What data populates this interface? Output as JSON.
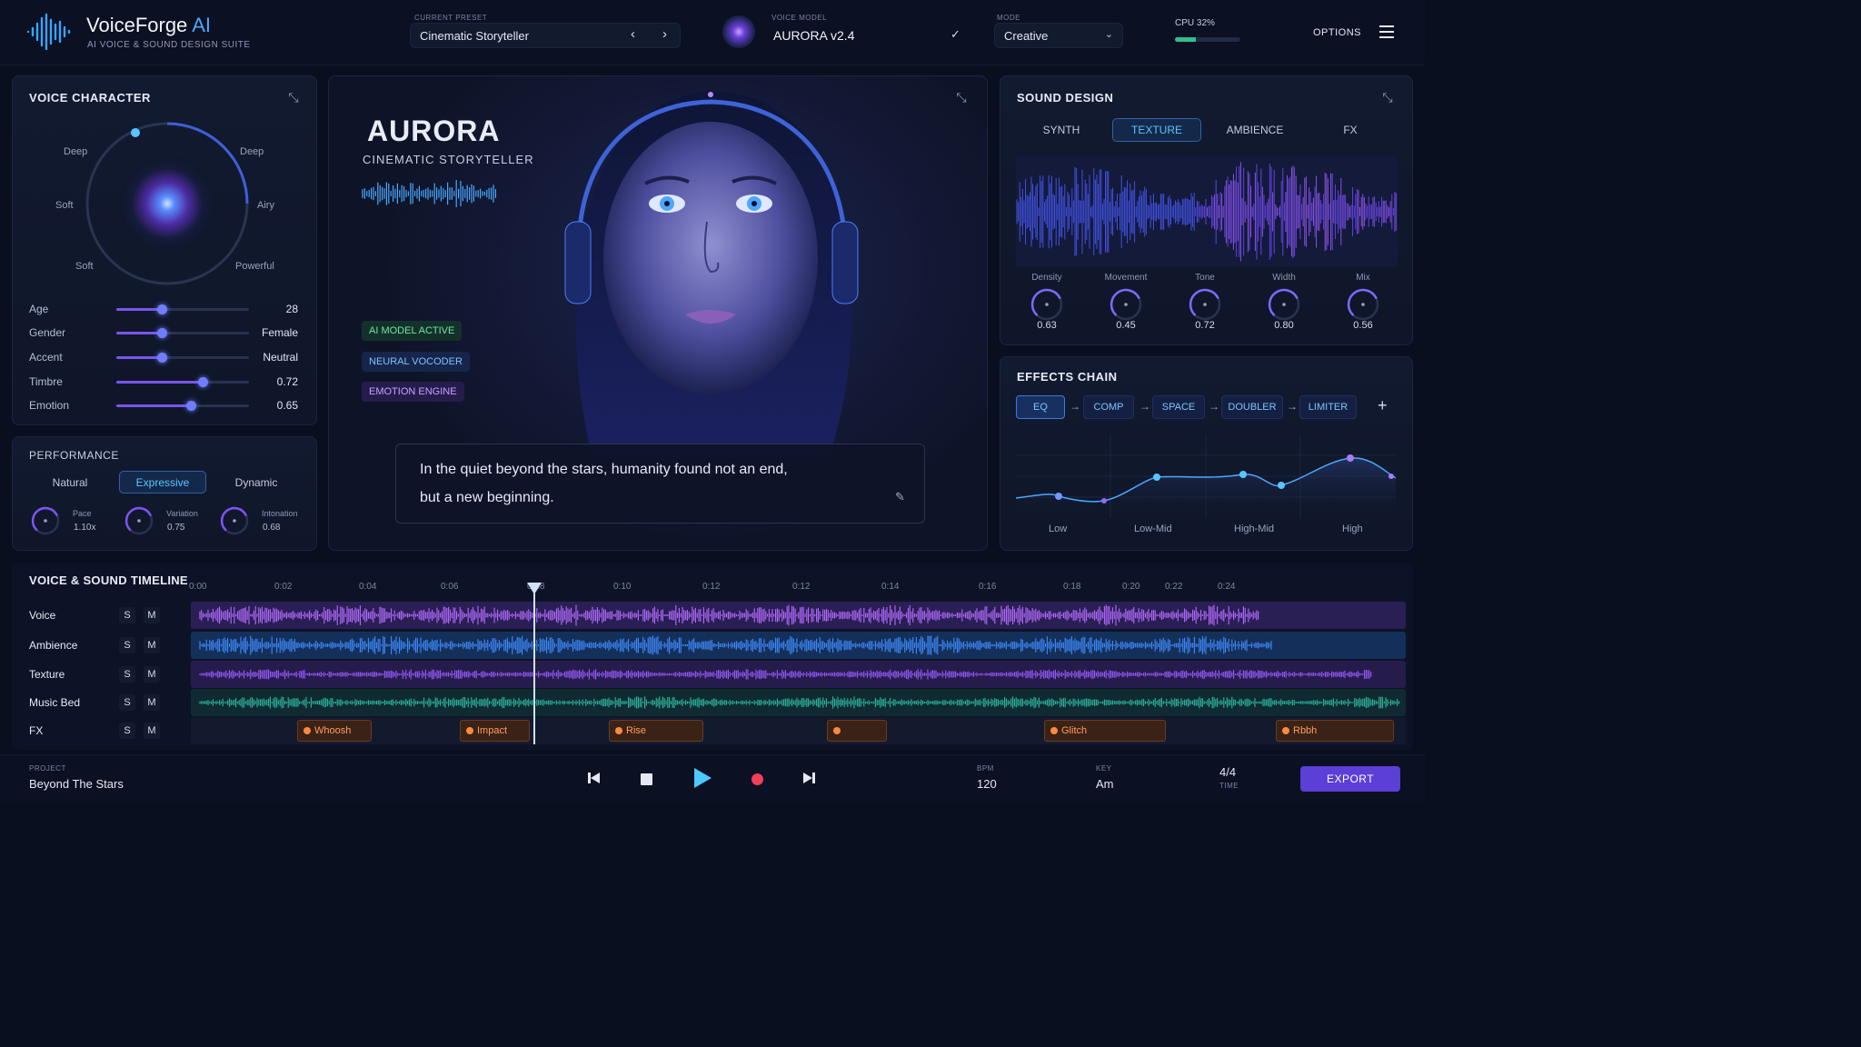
{
  "app": {
    "title_main": "VoiceForge",
    "title_accent": "AI",
    "subtitle": "AI VOICE & SOUND DESIGN SUITE"
  },
  "header": {
    "preset_label": "CURRENT PRESET",
    "preset_value": "Cinematic Storyteller",
    "model_label": "VOICE MODEL",
    "model_value": "AURORA v2.4",
    "mode_label": "MODE",
    "mode_value": "Creative",
    "cpu_label": "CPU 32%",
    "cpu_fraction": 0.32,
    "options_label": "OPTIONS"
  },
  "voice_character": {
    "title": "VOICE CHARACTER",
    "wheel_labels": [
      "Deep",
      "Deep",
      "Soft",
      "Airy",
      "Soft",
      "Powerful"
    ],
    "sliders": [
      {
        "name": "Age",
        "value": "28",
        "fraction": 0.34
      },
      {
        "name": "Gender",
        "value": "Female",
        "fraction": 0.34
      },
      {
        "name": "Accent",
        "value": "Neutral",
        "fraction": 0.34
      },
      {
        "name": "Timbre",
        "value": "0.72",
        "fraction": 0.65
      },
      {
        "name": "Emotion",
        "value": "0.65",
        "fraction": 0.56
      }
    ]
  },
  "performance": {
    "title": "PERFORMANCE",
    "modes": [
      "Natural",
      "Expressive",
      "Dynamic"
    ],
    "active_mode": "Expressive",
    "knobs": [
      {
        "name": "Pace",
        "value": "1.10x"
      },
      {
        "name": "Variation",
        "value": "0.75"
      },
      {
        "name": "Intonation",
        "value": "0.68"
      }
    ]
  },
  "hero": {
    "name": "AURORA",
    "role": "CINEMATIC STORYTELLER",
    "badges": [
      "AI MODEL ACTIVE",
      "NEURAL VOCODER",
      "EMOTION ENGINE"
    ],
    "script_text_1": "In the quiet beyond the stars, humanity found not an end,",
    "script_text_2": "but a new beginning."
  },
  "sound_design": {
    "title": "SOUND DESIGN",
    "tabs": [
      "SYNTH",
      "TEXTURE",
      "AMBIENCE",
      "FX"
    ],
    "active_tab": "TEXTURE",
    "knobs": [
      {
        "name": "Density",
        "value": "0.63"
      },
      {
        "name": "Movement",
        "value": "0.45"
      },
      {
        "name": "Tone",
        "value": "0.72"
      },
      {
        "name": "Width",
        "value": "0.80"
      },
      {
        "name": "Mix",
        "value": "0.56"
      }
    ]
  },
  "effects_chain": {
    "title": "EFFECTS CHAIN",
    "effects": [
      "EQ",
      "COMP",
      "SPACE",
      "DOUBLER",
      "LIMITER"
    ],
    "add_label": "+",
    "eq_bands": [
      "Low",
      "Low-Mid",
      "High-Mid",
      "High"
    ]
  },
  "timeline": {
    "title": "VOICE & SOUND TIMELINE",
    "ticks": [
      "0:00",
      "0:02",
      "0:04",
      "0:06",
      "0:08",
      "0:10",
      "0:12",
      "0:12",
      "0:14",
      "0:16",
      "0:18",
      "0:20",
      "0:22",
      "0:24"
    ],
    "solo_label": "S",
    "mute_label": "M",
    "tracks": [
      "Voice",
      "Ambience",
      "Texture",
      "Music Bed",
      "FX"
    ],
    "fx_clips": [
      "Whoosh",
      "Impact",
      "Rise",
      "",
      "Glitch",
      "Rbbh"
    ]
  },
  "footer": {
    "project_label": "PROJECT",
    "project_value": "Beyond The Stars",
    "bpm_label": "BPM",
    "bpm_value": "120",
    "key_label": "KEY",
    "key_value": "Am",
    "time_sig": "4/4",
    "time_label": "TIME",
    "export_label": "EXPORT"
  },
  "colors": {
    "accent_blue": "#58c6ff",
    "accent_purple": "#8b5cf6",
    "export": "#5b3fd6",
    "fx_orange": "#ff9d5c",
    "badge_green": "#6ee7a0"
  }
}
